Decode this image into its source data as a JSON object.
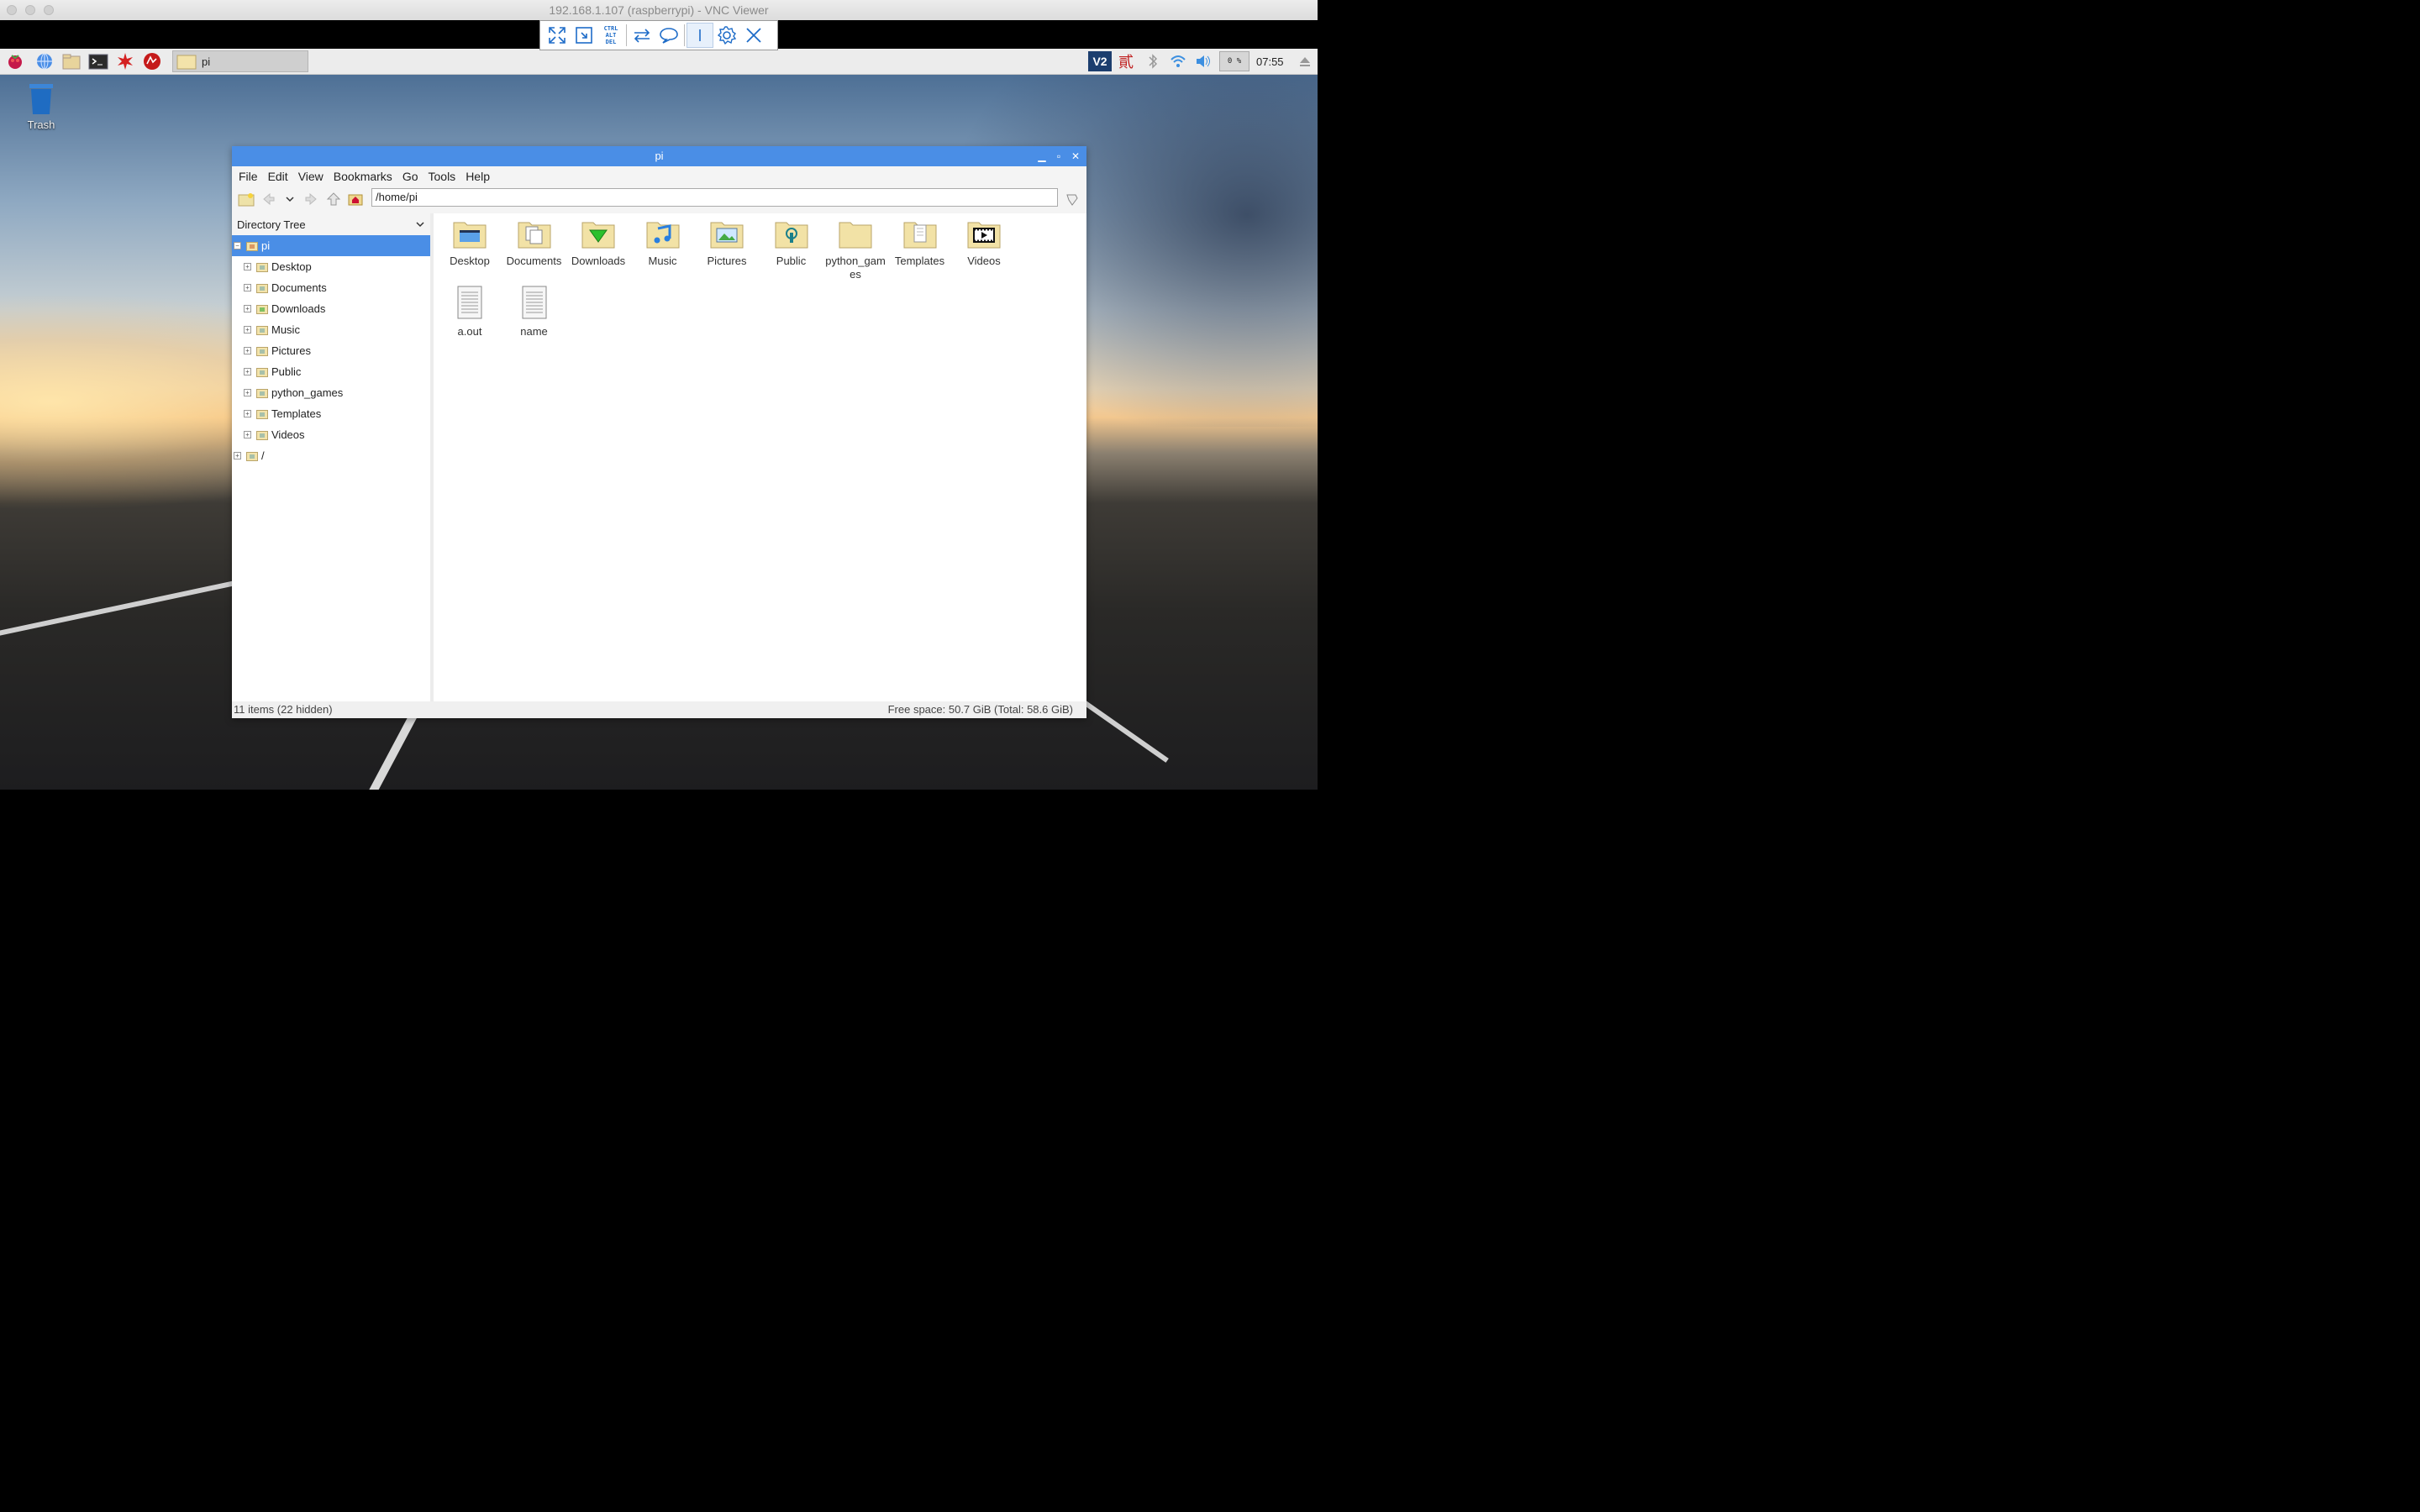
{
  "host_window": {
    "title": "192.168.1.107 (raspberrypi) - VNC Viewer"
  },
  "vnc_toolbar": {
    "buttons": [
      "fullscreen-icon",
      "scale-icon",
      "ctrl-alt-del-icon",
      "transfer-icon",
      "chat-icon",
      "info-icon",
      "settings-icon",
      "close-icon"
    ],
    "ctrl_alt_del": [
      "CTRL",
      "ALT",
      "DEL"
    ]
  },
  "panel": {
    "launchers": [
      "raspberry-menu-icon",
      "web-browser-icon",
      "file-manager-icon",
      "terminal-icon",
      "mathematica-icon",
      "wolfram-icon"
    ],
    "task_label": "pi",
    "cpu": "0 %",
    "clock": "07:55",
    "tray": [
      "vnc-server-icon",
      "chinese-input-icon",
      "bluetooth-icon",
      "wifi-icon",
      "volume-icon",
      "eject-icon"
    ]
  },
  "desktop": {
    "trash_label": "Trash"
  },
  "file_manager": {
    "title": "pi",
    "menu": [
      "File",
      "Edit",
      "View",
      "Bookmarks",
      "Go",
      "Tools",
      "Help"
    ],
    "path": "/home/pi",
    "sidebar_header": "Directory Tree",
    "tree": [
      {
        "label": "pi",
        "selected": true,
        "level": 0
      },
      {
        "label": "Desktop",
        "level": 1
      },
      {
        "label": "Documents",
        "level": 1
      },
      {
        "label": "Downloads",
        "level": 1
      },
      {
        "label": "Music",
        "level": 1
      },
      {
        "label": "Pictures",
        "level": 1
      },
      {
        "label": "Public",
        "level": 1
      },
      {
        "label": "python_games",
        "level": 1
      },
      {
        "label": "Templates",
        "level": 1
      },
      {
        "label": "Videos",
        "level": 1
      },
      {
        "label": "/",
        "level": 0
      }
    ],
    "items": [
      {
        "label": "Desktop",
        "kind": "folder"
      },
      {
        "label": "Documents",
        "kind": "folder"
      },
      {
        "label": "Downloads",
        "kind": "folder"
      },
      {
        "label": "Music",
        "kind": "folder"
      },
      {
        "label": "Pictures",
        "kind": "folder"
      },
      {
        "label": "Public",
        "kind": "folder"
      },
      {
        "label": "python_gam es",
        "kind": "folder"
      },
      {
        "label": "Templates",
        "kind": "folder"
      },
      {
        "label": "Videos",
        "kind": "folder"
      },
      {
        "label": "a.out",
        "kind": "file"
      },
      {
        "label": "name",
        "kind": "file"
      }
    ],
    "status_left": "11 items (22 hidden)",
    "status_right": "Free space: 50.7 GiB (Total: 58.6 GiB)"
  },
  "colors": {
    "accent": "#4a8ee6",
    "folder": "#f3deA0"
  }
}
